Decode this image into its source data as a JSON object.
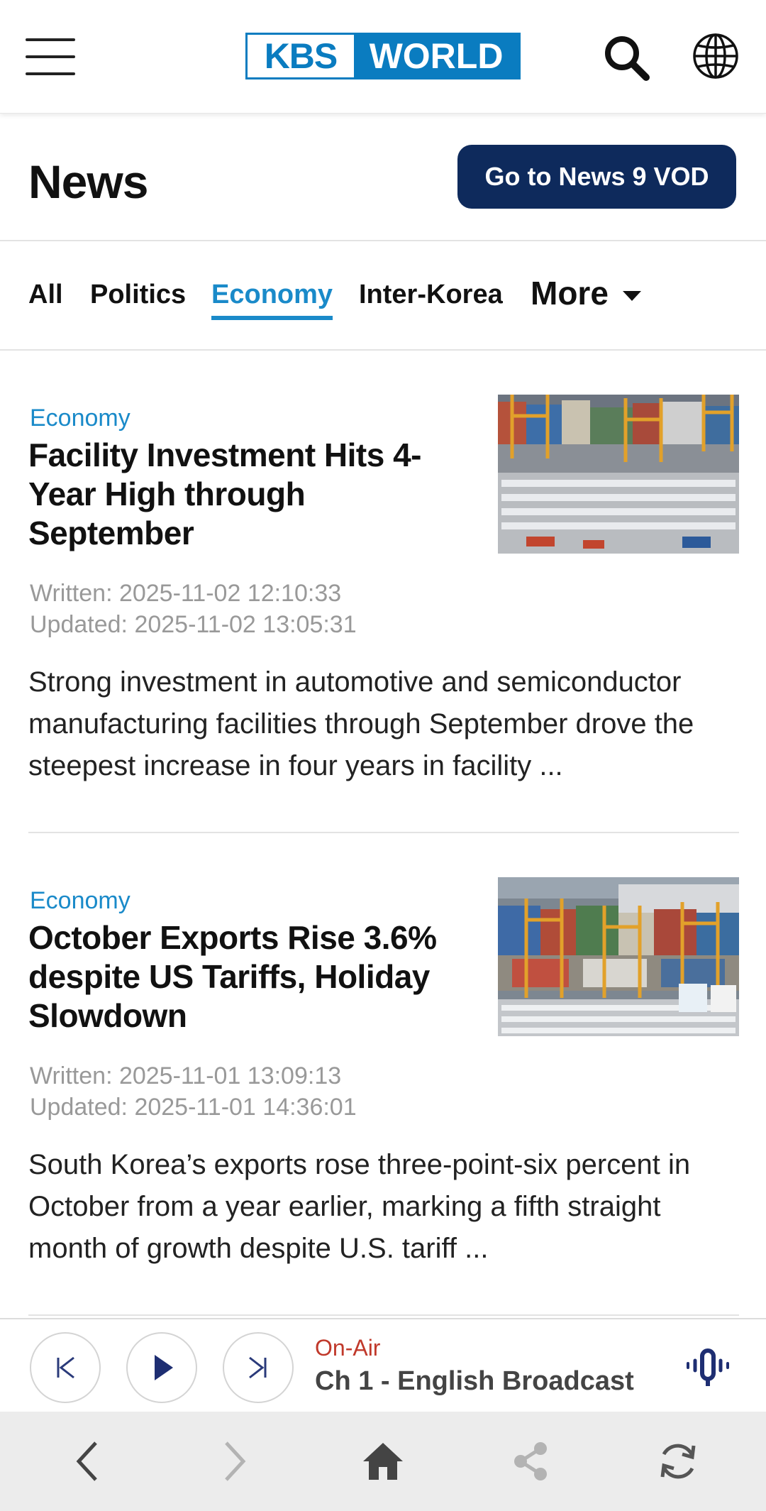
{
  "header": {
    "logo_left": "KBS",
    "logo_right": "WORLD",
    "brand_color": "#0a7cc0"
  },
  "title_row": {
    "title": "News",
    "vod_button": "Go to News 9 VOD",
    "vod_color": "#0e2a5c"
  },
  "tabs": {
    "items": [
      "All",
      "Politics",
      "Economy",
      "Inter-Korea"
    ],
    "active": "Economy",
    "more_label": "More",
    "accent": "#1a8ac9"
  },
  "articles": [
    {
      "category": "Economy",
      "headline": "Facility Investment Hits 4-Year High through September",
      "written": "Written: 2025-11-02 12:10:33",
      "updated": "Updated: 2025-11-02 13:05:31",
      "summary": "Strong investment in automotive and semiconductor manufacturing facilities through September drove the steepest increase in four years in facility ..."
    },
    {
      "category": "Economy",
      "headline": "October Exports Rise 3.6% despite US Tariffs, Holiday Slowdown",
      "written": "Written: 2025-11-01 13:09:13",
      "updated": "Updated: 2025-11-01 14:36:01",
      "summary": "South Korea’s exports rose three-point-six percent in October from a year earlier, marking a fifth straight month of growth despite U.S. tariff ..."
    }
  ],
  "player": {
    "status": "On-Air",
    "channel": "Ch 1 - English Broadcast",
    "status_color": "#c0392b"
  },
  "icons": [
    "menu-icon",
    "search-icon",
    "globe-icon",
    "skip-previous-icon",
    "play-icon",
    "skip-next-icon",
    "microphone-icon",
    "back-icon",
    "forward-icon",
    "home-icon",
    "share-icon",
    "refresh-icon"
  ]
}
